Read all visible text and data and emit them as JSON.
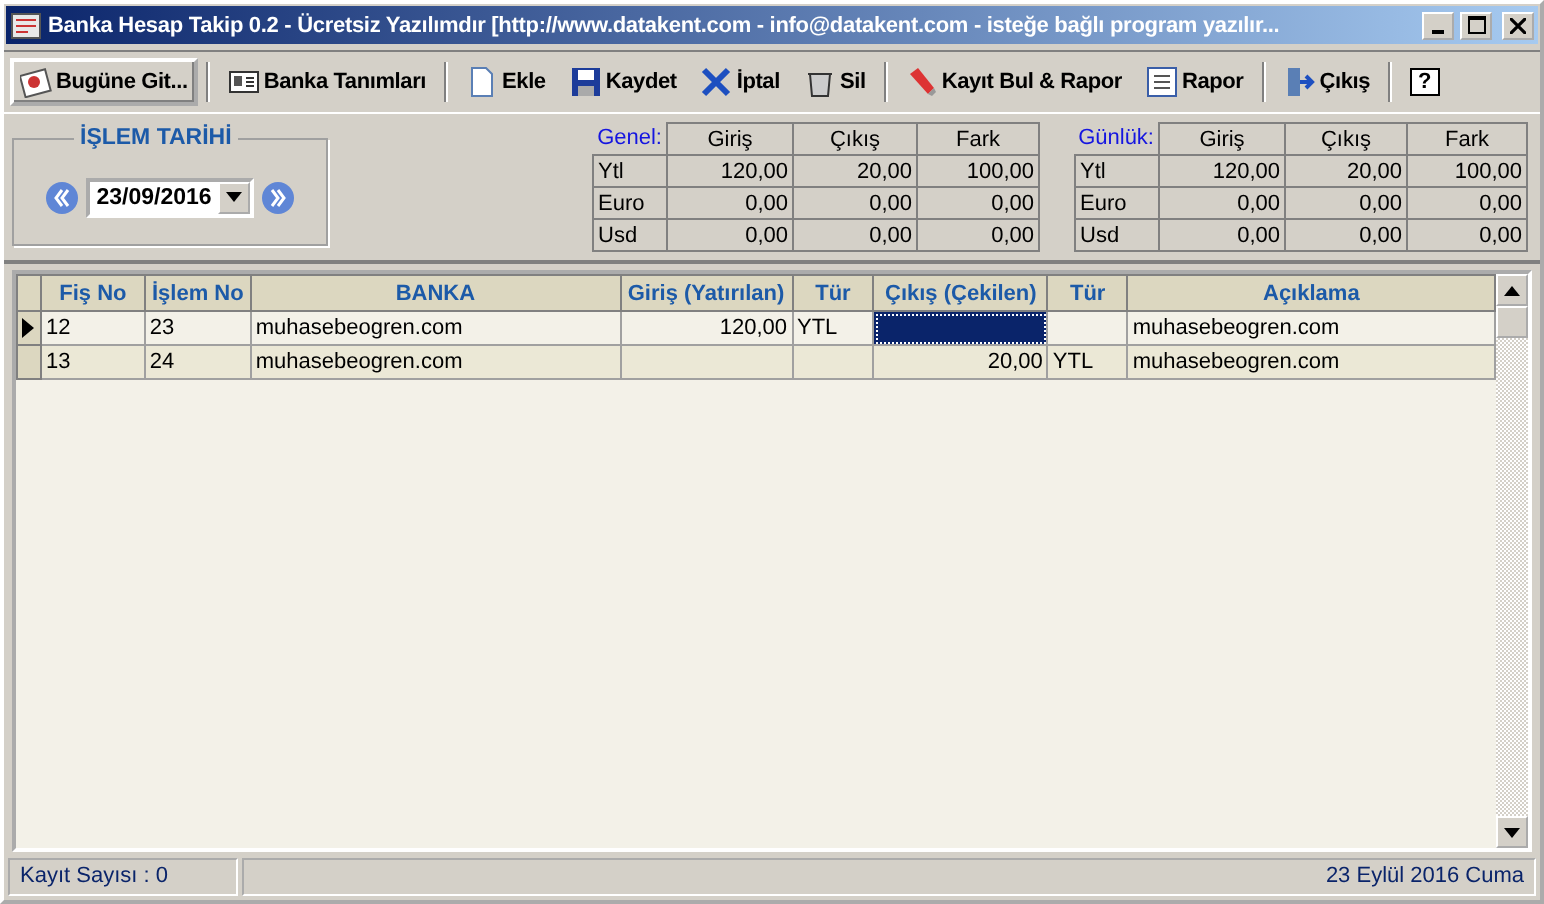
{
  "window": {
    "title": "Banka Hesap Takip 0.2 - Ücretsiz Yazılımdır [http://www.datakent.com - info@datakent.com - isteğe bağlı program yazılır..."
  },
  "toolbar": [
    {
      "label": "Bugüne Git...",
      "focused": true
    },
    {
      "label": "Banka Tanımları",
      "focused": false
    },
    {
      "label": "Ekle",
      "focused": false
    },
    {
      "label": "Kaydet",
      "focused": false
    },
    {
      "label": "İptal",
      "focused": false
    },
    {
      "label": "Sil",
      "focused": false
    },
    {
      "label": "Kayıt Bul & Rapor",
      "focused": false
    },
    {
      "label": "Rapor",
      "focused": false
    },
    {
      "label": "Çıkış",
      "focused": false
    },
    {
      "label": "?",
      "focused": false
    }
  ],
  "date_group": {
    "title": "İŞLEM TARİHİ",
    "value": "23/09/2016"
  },
  "summaries": [
    {
      "label": "Genel:",
      "columns": [
        "",
        "Giriş",
        "Çıkış",
        "Fark"
      ],
      "rows": [
        [
          "Ytl",
          "120,00",
          "20,00",
          "100,00"
        ],
        [
          "Euro",
          "0,00",
          "0,00",
          "0,00"
        ],
        [
          "Usd",
          "0,00",
          "0,00",
          "0,00"
        ]
      ]
    },
    {
      "label": "Günlük:",
      "columns": [
        "",
        "Giriş",
        "Çıkış",
        "Fark"
      ],
      "rows": [
        [
          "Ytl",
          "120,00",
          "20,00",
          "100,00"
        ],
        [
          "Euro",
          "0,00",
          "0,00",
          "0,00"
        ],
        [
          "Usd",
          "0,00",
          "0,00",
          "0,00"
        ]
      ]
    }
  ],
  "table": {
    "columns": [
      "Fiş No",
      "İşlem No",
      "BANKA",
      "Giriş (Yatırılan)",
      "Tür",
      "Çıkış (Çekilen)",
      "Tür",
      "Açıklama"
    ],
    "rows": [
      {
        "current": true,
        "cells": [
          {
            "text": "12",
            "selected": false
          },
          {
            "text": "23",
            "selected": false
          },
          {
            "text": "muhasebeogren.com",
            "selected": false
          },
          {
            "text": "120,00",
            "selected": false
          },
          {
            "text": "YTL",
            "selected": false
          },
          {
            "selected": true
          },
          {
            "selected": false
          },
          {
            "text": "muhasebeogren.com",
            "selected": false
          }
        ]
      },
      {
        "current": false,
        "cells": [
          {
            "text": "13",
            "selected": false
          },
          {
            "text": "24",
            "selected": false
          },
          {
            "text": "muhasebeogren.com",
            "selected": false
          },
          {
            "selected": false
          },
          {
            "selected": false
          },
          {
            "text": "20,00",
            "selected": false
          },
          {
            "text": "YTL",
            "selected": false
          },
          {
            "text": "muhasebeogren.com",
            "selected": false
          }
        ]
      }
    ]
  },
  "status_bar": {
    "record_count": "Kayıt Sayısı : 0",
    "date": "23 Eylül 2016 Cuma"
  }
}
